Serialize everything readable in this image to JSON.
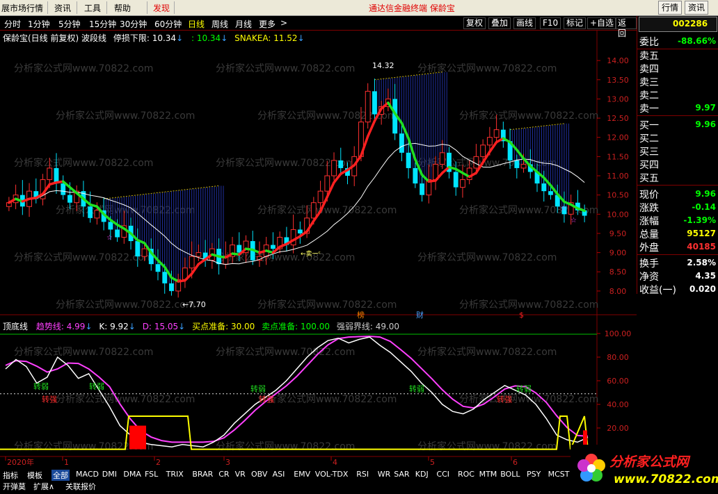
{
  "menubar": {
    "items": [
      "展市场行情",
      "资讯",
      "工具",
      "帮助",
      "发现"
    ],
    "center_title": "通达信金融终端   保龄宝",
    "right_buttons": [
      "行情",
      "资讯"
    ]
  },
  "periodbar": {
    "periods": [
      "分时",
      "1分钟",
      "5分钟",
      "15分钟",
      "30分钟",
      "60分钟",
      "日线",
      "周线",
      "月线",
      "更多"
    ],
    "active": "日线",
    "more_arrow": ">",
    "right_buttons": [
      "复权",
      "叠加",
      "画线",
      "F10",
      "标记",
      "+自选",
      "返回"
    ]
  },
  "main_legend": {
    "title": "保龄宝(日线 前复权) 波段线",
    "stop_label": "停损下限:",
    "stop_value": "10.34",
    "v2_label": ":",
    "v2_value": "10.34",
    "snake_label": "SNAKEA:",
    "snake_value": "11.52"
  },
  "price_axis": [
    "14.00",
    "13.50",
    "13.00",
    "12.50",
    "12.00",
    "11.50",
    "11.00",
    "10.50",
    "10.00",
    "9.50",
    "9.00",
    "8.50",
    "8.00"
  ],
  "annotations": {
    "high": "14.32",
    "low": "7.70",
    "arrow_label": "←卖一ᶜ"
  },
  "events": [
    "榜",
    "财",
    "$"
  ],
  "sub_legend": {
    "name": "顶底线",
    "trend_label": "趋势线:",
    "trend_value": "4.99",
    "k_label": "K:",
    "k_value": "9.92",
    "d_label": "D:",
    "d_value": "15.05",
    "buy_label": "买点准备:",
    "buy_value": "30.00",
    "sell_label": "卖点准备:",
    "sell_value": "100.00",
    "strong_label": "强弱界线:",
    "strong_value": "49.00"
  },
  "sub_axis": [
    "100.00",
    "80.00",
    "60.00",
    "40.00",
    "20.00"
  ],
  "sub_marks": {
    "weak": "转弱",
    "strong": "转强"
  },
  "date_axis": [
    "2020年",
    "1",
    "2",
    "3",
    "4",
    "5",
    "6"
  ],
  "right_panel": {
    "code": "002286",
    "rows": [
      {
        "label": "委比",
        "value": "-88.66%",
        "color": "#00ff00"
      },
      {
        "label": "卖五",
        "value": "",
        "color": "#fff"
      },
      {
        "label": "卖四",
        "value": "",
        "color": "#fff"
      },
      {
        "label": "卖三",
        "value": "",
        "color": "#fff"
      },
      {
        "label": "卖二",
        "value": "",
        "color": "#fff"
      },
      {
        "label": "卖一",
        "value": "9.97",
        "color": "#00ff00"
      },
      {
        "label": "买一",
        "value": "9.96",
        "color": "#00ff00"
      },
      {
        "label": "买二",
        "value": "",
        "color": "#fff"
      },
      {
        "label": "买三",
        "value": "",
        "color": "#fff"
      },
      {
        "label": "买四",
        "value": "",
        "color": "#fff"
      },
      {
        "label": "买五",
        "value": "",
        "color": "#fff"
      },
      {
        "label": "现价",
        "value": "9.96",
        "color": "#00ff00"
      },
      {
        "label": "涨跌",
        "value": "-0.14",
        "color": "#00ff00"
      },
      {
        "label": "涨幅",
        "value": "-1.39%",
        "color": "#00ff00"
      },
      {
        "label": "总量",
        "value": "95127",
        "color": "#ffff00"
      },
      {
        "label": "外盘",
        "value": "40185",
        "color": "#ff3030"
      },
      {
        "label": "换手",
        "value": "2.58%",
        "color": "#fff"
      },
      {
        "label": "净资",
        "value": "4.35",
        "color": "#fff"
      },
      {
        "label": "收益(一)",
        "value": "0.020",
        "color": "#fff"
      }
    ]
  },
  "bottom_tabs": [
    "指标",
    "模板",
    "全部",
    "MACD",
    "DMI",
    "DMA",
    "FSL",
    "TRIX",
    "BRAR",
    "CR",
    "VR",
    "OBV",
    "ASI",
    "EMV",
    "VOL-TDX",
    "RSI",
    "WR",
    "SAR",
    "KDJ",
    "CCI",
    "ROC",
    "MTM",
    "BOLL",
    "PSY",
    "MCST"
  ],
  "bottom_tabs_selected": "全部",
  "bottom_row2": [
    "开弹莫",
    "扩展∧",
    "关联报价"
  ],
  "watermark": "分析家公式网www.70822.com",
  "logo": {
    "title": "分析家公式网",
    "url": "www.70822.com"
  },
  "chart_data": {
    "type": "candlestick",
    "ylim": [
      7.6,
      14.4
    ],
    "closes": [
      10.3,
      10.5,
      10.2,
      10.6,
      10.4,
      10.9,
      11.2,
      10.8,
      10.5,
      10.3,
      10.6,
      10.2,
      9.9,
      10.1,
      9.8,
      9.6,
      9.4,
      9.7,
      9.3,
      8.9,
      9.1,
      8.7,
      8.5,
      8.2,
      8.0,
      8.3,
      8.6,
      8.9,
      9.0,
      8.8,
      9.1,
      8.7,
      8.9,
      9.2,
      9.0,
      9.3,
      8.8,
      8.9,
      9.2,
      9.1,
      9.4,
      9.2,
      9.6,
      9.5,
      9.9,
      10.3,
      10.6,
      11.0,
      11.4,
      11.2,
      11.0,
      11.5,
      12.4,
      13.2,
      12.6,
      12.8,
      13.0,
      12.1,
      11.6,
      11.2,
      10.8,
      10.5,
      10.9,
      11.3,
      11.6,
      11.1,
      10.7,
      10.9,
      11.2,
      11.5,
      11.8,
      12.0,
      12.2,
      11.9,
      11.4,
      11.2,
      11.3,
      11.1,
      10.8,
      10.6,
      10.5,
      10.2,
      10.0,
      10.3,
      10.1,
      9.96
    ],
    "band_ylim": [
      0,
      100
    ]
  }
}
